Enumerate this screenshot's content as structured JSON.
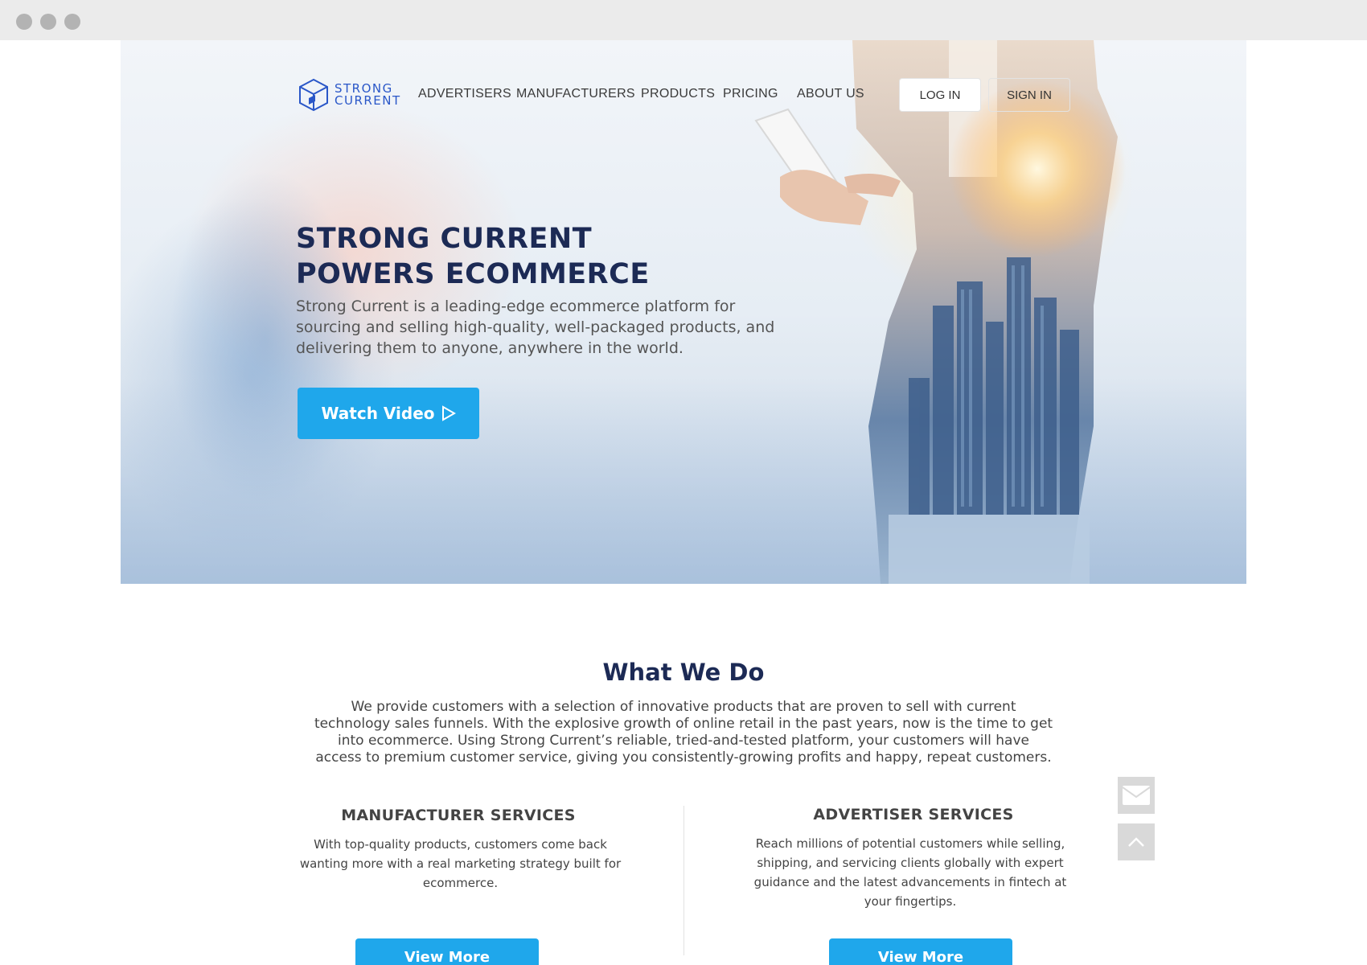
{
  "brand": {
    "name_line1": "STRONG",
    "name_line2": "CURRENT",
    "accent": "#2a57c8",
    "primary": "#1fa7eb",
    "heading": "#1c2a55"
  },
  "nav": {
    "items": [
      "ADVERTISERS",
      "MANUFACTURERS",
      "PRODUCTS",
      "PRICING",
      "ABOUT US"
    ],
    "login_label": "LOG IN",
    "signin_label": "SIGN IN"
  },
  "hero": {
    "title_line1": "STRONG CURRENT",
    "title_line2": "POWERS ECOMMERCE",
    "subtitle": "Strong Current is a leading-edge ecommerce platform for sourcing and selling high-quality, well-packaged products, and delivering them to anyone, anywhere in the world.",
    "cta_label": "Watch Video",
    "cta_icon": "play-icon"
  },
  "what_we_do": {
    "title": "What We Do",
    "body": "We provide customers with a selection of innovative products that are proven to sell with current technology sales funnels. With the explosive growth of online retail in the past years, now is the time to get into ecommerce. Using Strong Current’s reliable, tried-and-tested platform, your customers will have access to premium customer service, giving you consistently-growing profits and happy, repeat customers."
  },
  "services": [
    {
      "title": "MANUFACTURER SERVICES",
      "body": "With top-quality products, customers come back wanting more with a real marketing strategy built for ecommerce.",
      "button": "View More"
    },
    {
      "title": "ADVERTISER SERVICES",
      "body": "Reach millions of potential customers while selling, shipping, and servicing clients globally with expert guidance and the latest advancements in fintech at your fingertips.",
      "button": "View More"
    }
  ],
  "floating": {
    "mail_icon": "mail-icon",
    "top_icon": "chevron-up-icon"
  }
}
